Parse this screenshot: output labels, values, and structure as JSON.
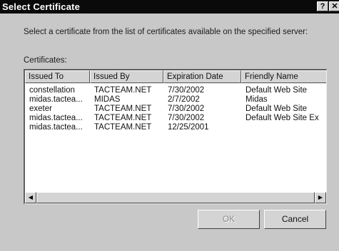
{
  "window": {
    "title": "Select Certificate",
    "help_label": "?",
    "close_label": "✕"
  },
  "instruction": "Select a certificate from the list of certificates available on the specified server:",
  "list_label": "Certificates:",
  "columns": [
    "Issued To",
    "Issued By",
    "Expiration Date",
    "Friendly Name"
  ],
  "rows": [
    [
      "constellation",
      "TACTEAM.NET",
      "7/30/2002",
      "Default Web Site"
    ],
    [
      "midas.tactea...",
      "MIDAS",
      "2/7/2002",
      "Midas"
    ],
    [
      "exeter",
      "TACTEAM.NET",
      "7/30/2002",
      "Default Web Site"
    ],
    [
      "midas.tactea...",
      "TACTEAM.NET",
      "7/30/2002",
      "Default Web Site Ex"
    ],
    [
      "midas.tactea...",
      "TACTEAM.NET",
      "12/25/2001",
      ""
    ]
  ],
  "scrollbar": {
    "left_arrow": "◀",
    "right_arrow": "▶"
  },
  "buttons": {
    "ok": "OK",
    "cancel": "Cancel"
  }
}
